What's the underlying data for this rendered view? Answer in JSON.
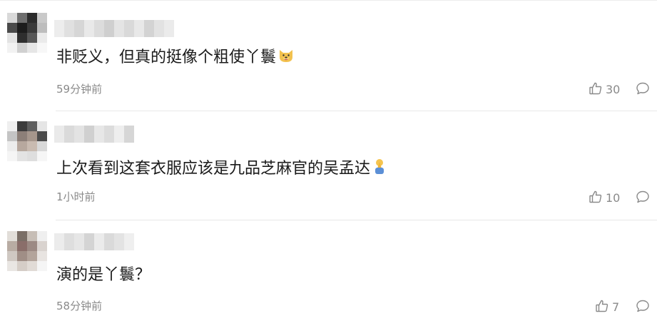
{
  "comments": [
    {
      "text": "非贬义，但真的挺像个粗使丫鬟",
      "emoji": "doge-emoji",
      "time": "59分钟前",
      "likes": "30"
    },
    {
      "text": "上次看到这套衣服应该是九品芝麻官的吴孟达",
      "emoji": "pray-emoji",
      "time": "1小时前",
      "likes": "10"
    },
    {
      "text": "演的是丫鬟？",
      "emoji": "",
      "time": "58分钟前",
      "likes": "7"
    }
  ],
  "icons": {
    "like": "thumbs-up-icon",
    "reply": "comment-bubble-icon"
  },
  "colors": {
    "meta_text": "#8a8a8a",
    "body_text": "#1a1a1a",
    "divider": "#e8e8e8"
  }
}
